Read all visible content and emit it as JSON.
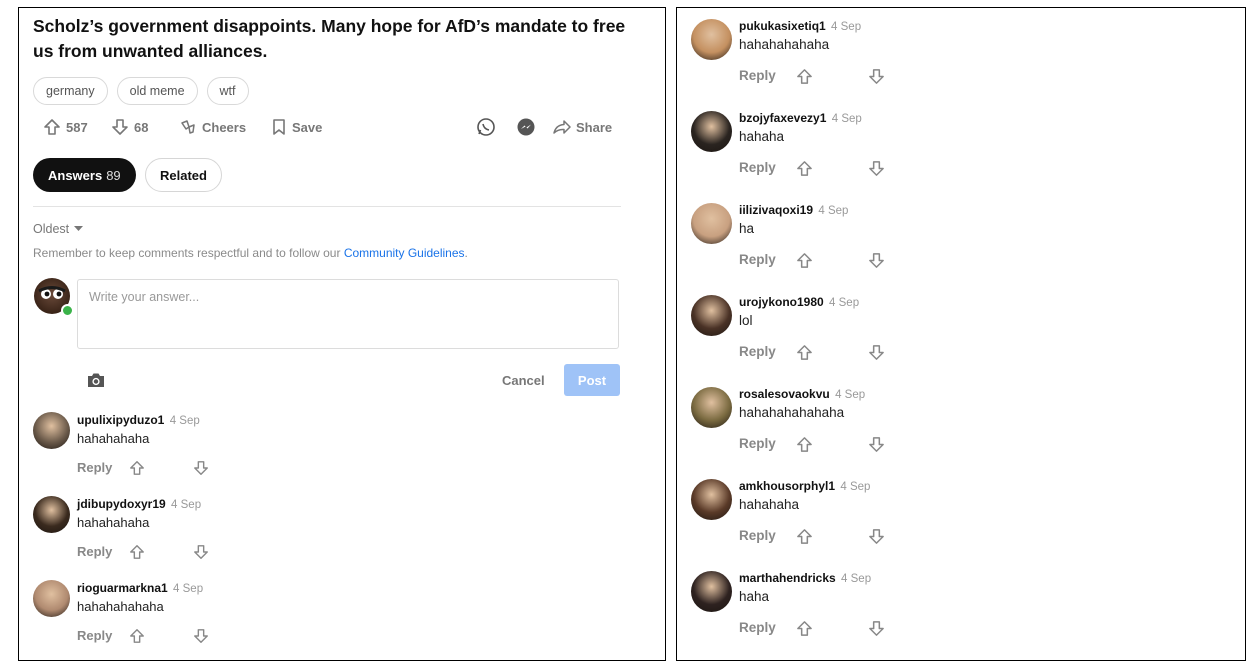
{
  "post": {
    "title": "Scholz’s government disappoints. Many hope for AfD’s mandate to free us from unwanted alliances.",
    "tags": [
      "germany",
      "old meme",
      "wtf"
    ],
    "upvotes": "587",
    "downvotes": "68",
    "cheers_label": "Cheers",
    "save_label": "Save",
    "share_label": "Share"
  },
  "tabs": {
    "answers_label": "Answers",
    "answers_count": "89",
    "related_label": "Related"
  },
  "sort": {
    "label": "Oldest"
  },
  "guidelines": {
    "text": "Remember to keep comments respectful and to follow our ",
    "link": "Community Guidelines",
    "suffix": "."
  },
  "composer": {
    "placeholder": "Write your answer...",
    "cancel_label": "Cancel",
    "post_label": "Post"
  },
  "reply_label": "Reply",
  "left_comments": [
    {
      "username": "upulixipyduzo1",
      "date": "4 Sep",
      "text": "hahahahaha",
      "avatar_color": "#6b5a4a"
    },
    {
      "username": "jdibupydoxyr19",
      "date": "4 Sep",
      "text": "hahahahaha",
      "avatar_color": "#3a2a1e"
    },
    {
      "username": "rioguarmarkna1",
      "date": "4 Sep",
      "text": "hahahahahaha",
      "avatar_color": "#b08a70"
    }
  ],
  "right_comments": [
    {
      "username": "pukukasixetiq1",
      "date": "4 Sep",
      "text": "hahahahahaha",
      "avatar_color": "#c49060"
    },
    {
      "username": "bzojyfaxevezy1",
      "date": "4 Sep",
      "text": "hahaha",
      "avatar_color": "#2a2420"
    },
    {
      "username": "iilizivaqoxi19",
      "date": "4 Sep",
      "text": "ha",
      "avatar_color": "#c8a080"
    },
    {
      "username": "urojykono1980",
      "date": "4 Sep",
      "text": "lol",
      "avatar_color": "#4a3226"
    },
    {
      "username": "rosalesovaokvu",
      "date": "4 Sep",
      "text": "hahahahahahaha",
      "avatar_color": "#7a6a40"
    },
    {
      "username": "amkhousorphyl1",
      "date": "4 Sep",
      "text": "hahahaha",
      "avatar_color": "#5a3a28"
    },
    {
      "username": "marthahendricks",
      "date": "4 Sep",
      "text": "haha",
      "avatar_color": "#2e2220"
    }
  ]
}
